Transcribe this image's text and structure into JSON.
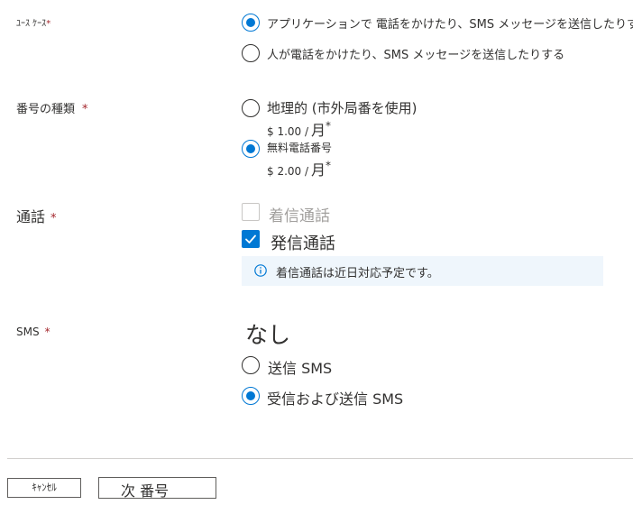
{
  "use_case": {
    "label": "ﾕｰｽ ｹｰｽ",
    "required_mark": "*",
    "options": [
      {
        "label": "アプリケーションで 電話をかけたり、SMS メッセージを送信したりする",
        "selected": true
      },
      {
        "label": "人が電話をかけたり、SMS メッセージを送信したりする",
        "selected": false
      }
    ]
  },
  "number_type": {
    "label": "番号の種類",
    "required_mark": "*",
    "options": [
      {
        "label": "地理的 (市外局番を使用)",
        "price": "$ 1.00 /",
        "unit": "月",
        "star": "*",
        "selected": false
      },
      {
        "label": "無料電話番号",
        "price": "$ 2.00 /",
        "unit": "月",
        "star": "*",
        "selected": true
      }
    ]
  },
  "calling": {
    "label": "通話",
    "required_mark": "*",
    "options": [
      {
        "label": "着信通話",
        "checked": false,
        "disabled": true
      },
      {
        "label": "発信通話",
        "checked": true,
        "disabled": false
      }
    ],
    "info_text": "着信通話は近日対応予定です。"
  },
  "sms": {
    "label": "SMS",
    "required_mark": "*",
    "options": [
      {
        "label": "なし",
        "selected": false
      },
      {
        "label": "送信 SMS",
        "selected": false
      },
      {
        "label": "受信および送信 SMS",
        "selected": true
      }
    ]
  },
  "footer": {
    "cancel_label": "ｷｬﾝｾﾙ",
    "next_label": "次 番号"
  },
  "colors": {
    "accent": "#0078d4",
    "required": "#a4262c",
    "info_background": "#eff6fc",
    "disabled": "#a19f9d"
  }
}
